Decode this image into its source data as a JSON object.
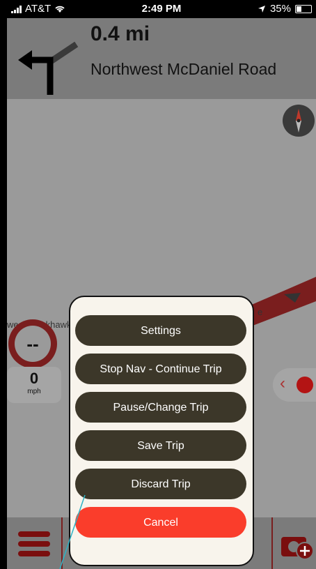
{
  "status_bar": {
    "carrier": "AT&T",
    "time": "2:49 PM",
    "battery": "35%"
  },
  "navigation": {
    "distance": "0.4 mi",
    "street": "Northwest McDaniel Road"
  },
  "map": {
    "road_label_left": "west Blackhawk",
    "road_label_right": "e"
  },
  "speed": {
    "limit": "--",
    "value": "0",
    "unit": "mph"
  },
  "dialog": {
    "settings": "Settings",
    "stop_nav": "Stop Nav - Continue Trip",
    "pause_change": "Pause/Change Trip",
    "save_trip": "Save Trip",
    "discard_trip": "Discard Trip",
    "cancel": "Cancel"
  },
  "colors": {
    "dialog_button": "#3c3729",
    "cancel_button": "#fa3d2b",
    "accent_red": "#b31414"
  }
}
